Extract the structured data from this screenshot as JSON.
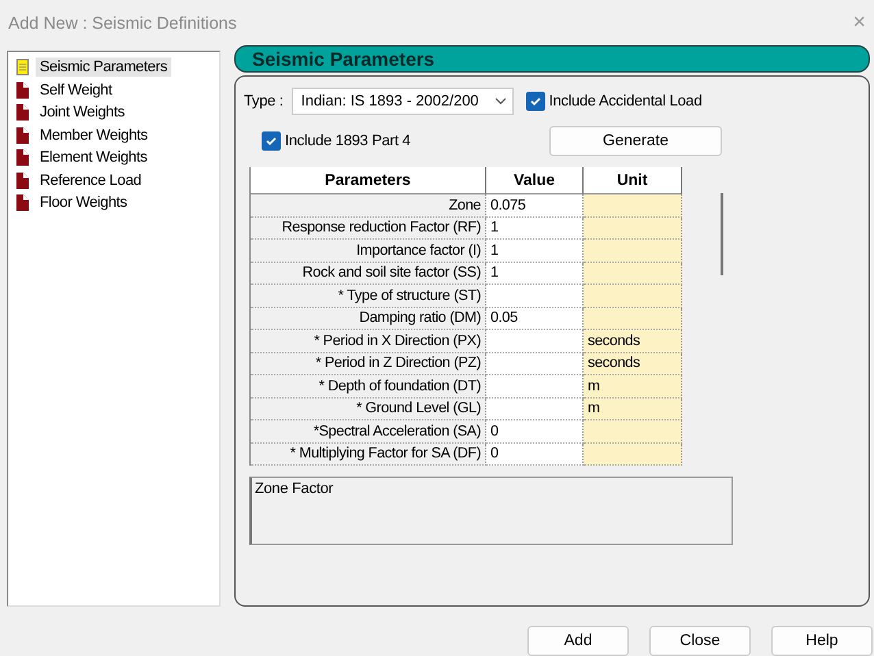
{
  "window": {
    "title": "Add New : Seismic Definitions",
    "close": "×"
  },
  "tree": [
    {
      "label": "Seismic Parameters",
      "kind": "definition",
      "selected": true
    },
    {
      "label": "Self Weight",
      "kind": "load",
      "selected": false
    },
    {
      "label": "Joint Weights",
      "kind": "load",
      "selected": false
    },
    {
      "label": "Member Weights",
      "kind": "load",
      "selected": false
    },
    {
      "label": "Element Weights",
      "kind": "load",
      "selected": false
    },
    {
      "label": "Reference Load",
      "kind": "load",
      "selected": false
    },
    {
      "label": "Floor Weights",
      "kind": "load",
      "selected": false
    }
  ],
  "panel": {
    "title": "Seismic Parameters",
    "type_label": "Type :",
    "type_value": "Indian: IS 1893 - 2002/200",
    "accidental": {
      "label": "Include Accidental Load",
      "checked": true
    },
    "part4": {
      "label": "Include 1893 Part 4",
      "checked": true
    },
    "generate": "Generate",
    "table": {
      "columns": [
        "Parameters",
        "Value",
        "Unit"
      ],
      "rows": [
        {
          "parameter": "Zone",
          "value": "0.075",
          "unit": ""
        },
        {
          "parameter": "Response reduction Factor (RF)",
          "value": "1",
          "unit": ""
        },
        {
          "parameter": "Importance factor (I)",
          "value": "1",
          "unit": ""
        },
        {
          "parameter": "Rock and soil site factor (SS)",
          "value": "1",
          "unit": ""
        },
        {
          "parameter": "* Type of structure (ST)",
          "value": "",
          "unit": ""
        },
        {
          "parameter": "Damping ratio (DM)",
          "value": "0.05",
          "unit": ""
        },
        {
          "parameter": "* Period in X Direction (PX)",
          "value": "",
          "unit": "seconds"
        },
        {
          "parameter": "* Period in Z Direction (PZ)",
          "value": "",
          "unit": "seconds"
        },
        {
          "parameter": "* Depth of foundation (DT)",
          "value": "",
          "unit": "m"
        },
        {
          "parameter": "* Ground Level (GL)",
          "value": "",
          "unit": "m"
        },
        {
          "parameter": "*Spectral Acceleration (SA)",
          "value": "0",
          "unit": ""
        },
        {
          "parameter": "* Multiplying Factor for SA (DF)",
          "value": "0",
          "unit": ""
        }
      ]
    },
    "description": "Zone Factor"
  },
  "buttons": [
    "Add",
    "Close",
    "Help"
  ]
}
